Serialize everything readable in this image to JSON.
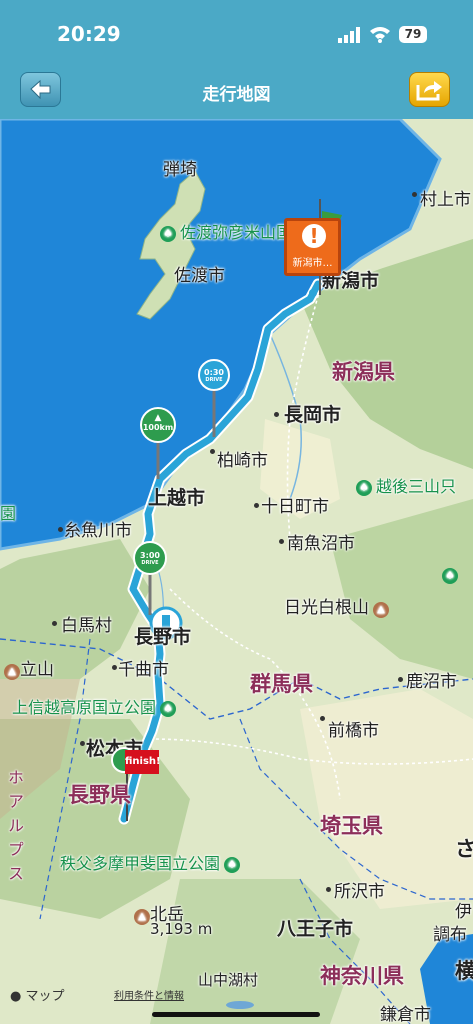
{
  "status_bar": {
    "time": "20:29",
    "battery": "79"
  },
  "nav": {
    "title": "走行地図",
    "back_icon": "back-arrow-icon",
    "share_icon": "share-arrow-icon"
  },
  "map": {
    "labels": {
      "yahiko_park": "佐渡弥彦米山国定公園",
      "danzaki": "弾埼",
      "sado_city": "佐渡市",
      "murakami": "村上市",
      "niigata_city": "新潟市",
      "niigata_pref": "新潟県",
      "nagaoka": "長岡市",
      "kashiwazaki": "柏崎市",
      "echigo_park": "越後三山只",
      "joetsu": "上越市",
      "tokamachi": "十日町市",
      "itoigawa": "糸魚川市",
      "minamiuonuma": "南魚沼市",
      "left_park": "園",
      "right_park": "",
      "hakuba": "白馬村",
      "nagano_city": "長野市",
      "nikko_mountain": "日光白根山",
      "tateyama": "立山",
      "chikuma": "千曲市",
      "gunma_pref": "群馬県",
      "numata": "鹿沼市",
      "joshinetsu_park": "上信越高原国立公園",
      "maebashi": "前橋市",
      "matsumoto": "松本市",
      "nagano_pref": "長野県",
      "saitama_pref": "埼玉県",
      "chichibu_park": "秩父多摩甲斐国立公園",
      "tokorozawa": "所沢市",
      "kitadake": "北岳",
      "kitadake_elev": "3,193 m",
      "hachioji": "八王子市",
      "chofu": "調布",
      "kanagawa_pref": "神奈川県",
      "yamanakako": "山中湖村",
      "kamakura": "鎌倉市",
      "alps_vertical": "ホアルプス",
      "sa_edge": "さ",
      "yoko_edge": "横",
      "ito_partial": "伊"
    },
    "markers": {
      "destination_label": "新潟市…",
      "finish_flag": "finish!",
      "milestone_100": "100km",
      "milestone_0_30": "0:30",
      "milestone_3_00": "3:00",
      "milestone_drive": "DRIVE"
    }
  },
  "footer": {
    "apple_maps": "マップ",
    "legal": "利用条件と情報"
  },
  "colors": {
    "nav": "#4ba9c6",
    "sea": "#1f86d8",
    "land": "#dfe8c8",
    "route": "#2aa4d8",
    "destination": "#ee6b1b",
    "finish": "#d6101d",
    "milestone": "#2e9c4e",
    "prefecture_label": "#8c2e59",
    "park_label": "#17924c"
  },
  "icons": [
    "back-arrow-icon",
    "share-arrow-icon",
    "signal-icon",
    "wifi-icon",
    "battery-icon",
    "park-icon",
    "mountain-icon",
    "destination-marker-icon",
    "finish-flag-icon",
    "milestone-icon",
    "apple-logo-icon"
  ]
}
